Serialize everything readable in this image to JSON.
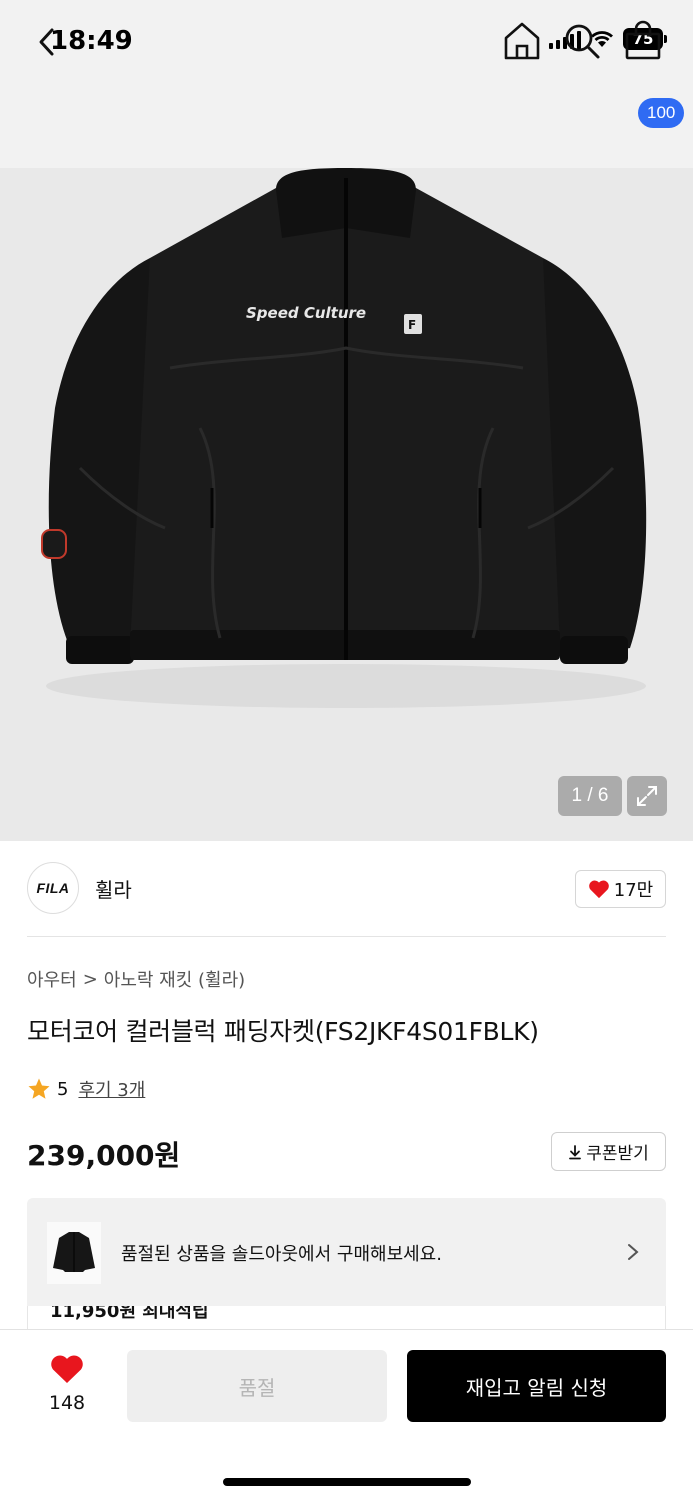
{
  "status_bar": {
    "time": "18:49",
    "battery": "75"
  },
  "nav": {
    "cart_badge": "100"
  },
  "image": {
    "counter": "1 / 6",
    "patch_text": "Speed Culture",
    "chest_logo": "F"
  },
  "brand": {
    "logo_text": "FILA",
    "name": "휠라",
    "likes": "17만"
  },
  "breadcrumb": {
    "level1": "아우터",
    "separator": ">",
    "level2": "아노락 재킷 (휠라)"
  },
  "product": {
    "title": "모터코어 컬러블럭 패딩자켓(FS2JKF4S01FBLK)",
    "rating": "5",
    "review_label": "후기 3개",
    "price": "239,000원"
  },
  "coupon": {
    "label": "쿠폰받기"
  },
  "soldout_banner": {
    "text": "품절된 상품을 솔드아웃에서 구매해보세요."
  },
  "points": {
    "text": "11,950원 최대적립"
  },
  "bottom": {
    "wish_count": "148",
    "soldout_label": "품절",
    "restock_label": "재입고 알림 신청"
  },
  "colors": {
    "accent": "#2f6bf3",
    "heart": "#e8161e",
    "primary_button": "#000000"
  }
}
